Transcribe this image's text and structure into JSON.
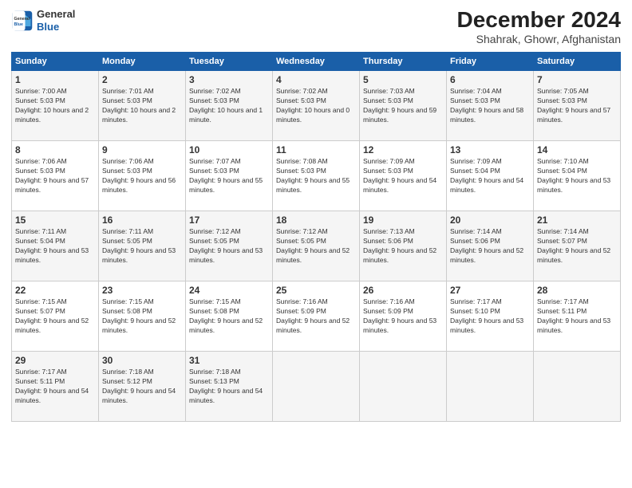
{
  "header": {
    "logo_line1": "General",
    "logo_line2": "Blue",
    "title": "December 2024",
    "subtitle": "Shahrak, Ghowr, Afghanistan"
  },
  "calendar": {
    "days_of_week": [
      "Sunday",
      "Monday",
      "Tuesday",
      "Wednesday",
      "Thursday",
      "Friday",
      "Saturday"
    ],
    "weeks": [
      [
        {
          "day": "1",
          "sunrise": "7:00 AM",
          "sunset": "5:03 PM",
          "daylight": "10 hours and 2 minutes."
        },
        {
          "day": "2",
          "sunrise": "7:01 AM",
          "sunset": "5:03 PM",
          "daylight": "10 hours and 2 minutes."
        },
        {
          "day": "3",
          "sunrise": "7:02 AM",
          "sunset": "5:03 PM",
          "daylight": "10 hours and 1 minute."
        },
        {
          "day": "4",
          "sunrise": "7:02 AM",
          "sunset": "5:03 PM",
          "daylight": "10 hours and 0 minutes."
        },
        {
          "day": "5",
          "sunrise": "7:03 AM",
          "sunset": "5:03 PM",
          "daylight": "9 hours and 59 minutes."
        },
        {
          "day": "6",
          "sunrise": "7:04 AM",
          "sunset": "5:03 PM",
          "daylight": "9 hours and 58 minutes."
        },
        {
          "day": "7",
          "sunrise": "7:05 AM",
          "sunset": "5:03 PM",
          "daylight": "9 hours and 57 minutes."
        }
      ],
      [
        {
          "day": "8",
          "sunrise": "7:06 AM",
          "sunset": "5:03 PM",
          "daylight": "9 hours and 57 minutes."
        },
        {
          "day": "9",
          "sunrise": "7:06 AM",
          "sunset": "5:03 PM",
          "daylight": "9 hours and 56 minutes."
        },
        {
          "day": "10",
          "sunrise": "7:07 AM",
          "sunset": "5:03 PM",
          "daylight": "9 hours and 55 minutes."
        },
        {
          "day": "11",
          "sunrise": "7:08 AM",
          "sunset": "5:03 PM",
          "daylight": "9 hours and 55 minutes."
        },
        {
          "day": "12",
          "sunrise": "7:09 AM",
          "sunset": "5:03 PM",
          "daylight": "9 hours and 54 minutes."
        },
        {
          "day": "13",
          "sunrise": "7:09 AM",
          "sunset": "5:04 PM",
          "daylight": "9 hours and 54 minutes."
        },
        {
          "day": "14",
          "sunrise": "7:10 AM",
          "sunset": "5:04 PM",
          "daylight": "9 hours and 53 minutes."
        }
      ],
      [
        {
          "day": "15",
          "sunrise": "7:11 AM",
          "sunset": "5:04 PM",
          "daylight": "9 hours and 53 minutes."
        },
        {
          "day": "16",
          "sunrise": "7:11 AM",
          "sunset": "5:05 PM",
          "daylight": "9 hours and 53 minutes."
        },
        {
          "day": "17",
          "sunrise": "7:12 AM",
          "sunset": "5:05 PM",
          "daylight": "9 hours and 53 minutes."
        },
        {
          "day": "18",
          "sunrise": "7:12 AM",
          "sunset": "5:05 PM",
          "daylight": "9 hours and 52 minutes."
        },
        {
          "day": "19",
          "sunrise": "7:13 AM",
          "sunset": "5:06 PM",
          "daylight": "9 hours and 52 minutes."
        },
        {
          "day": "20",
          "sunrise": "7:14 AM",
          "sunset": "5:06 PM",
          "daylight": "9 hours and 52 minutes."
        },
        {
          "day": "21",
          "sunrise": "7:14 AM",
          "sunset": "5:07 PM",
          "daylight": "9 hours and 52 minutes."
        }
      ],
      [
        {
          "day": "22",
          "sunrise": "7:15 AM",
          "sunset": "5:07 PM",
          "daylight": "9 hours and 52 minutes."
        },
        {
          "day": "23",
          "sunrise": "7:15 AM",
          "sunset": "5:08 PM",
          "daylight": "9 hours and 52 minutes."
        },
        {
          "day": "24",
          "sunrise": "7:15 AM",
          "sunset": "5:08 PM",
          "daylight": "9 hours and 52 minutes."
        },
        {
          "day": "25",
          "sunrise": "7:16 AM",
          "sunset": "5:09 PM",
          "daylight": "9 hours and 52 minutes."
        },
        {
          "day": "26",
          "sunrise": "7:16 AM",
          "sunset": "5:09 PM",
          "daylight": "9 hours and 53 minutes."
        },
        {
          "day": "27",
          "sunrise": "7:17 AM",
          "sunset": "5:10 PM",
          "daylight": "9 hours and 53 minutes."
        },
        {
          "day": "28",
          "sunrise": "7:17 AM",
          "sunset": "5:11 PM",
          "daylight": "9 hours and 53 minutes."
        }
      ],
      [
        {
          "day": "29",
          "sunrise": "7:17 AM",
          "sunset": "5:11 PM",
          "daylight": "9 hours and 54 minutes."
        },
        {
          "day": "30",
          "sunrise": "7:18 AM",
          "sunset": "5:12 PM",
          "daylight": "9 hours and 54 minutes."
        },
        {
          "day": "31",
          "sunrise": "7:18 AM",
          "sunset": "5:13 PM",
          "daylight": "9 hours and 54 minutes."
        },
        null,
        null,
        null,
        null
      ]
    ],
    "labels": {
      "sunrise": "Sunrise:",
      "sunset": "Sunset:",
      "daylight": "Daylight:"
    }
  }
}
